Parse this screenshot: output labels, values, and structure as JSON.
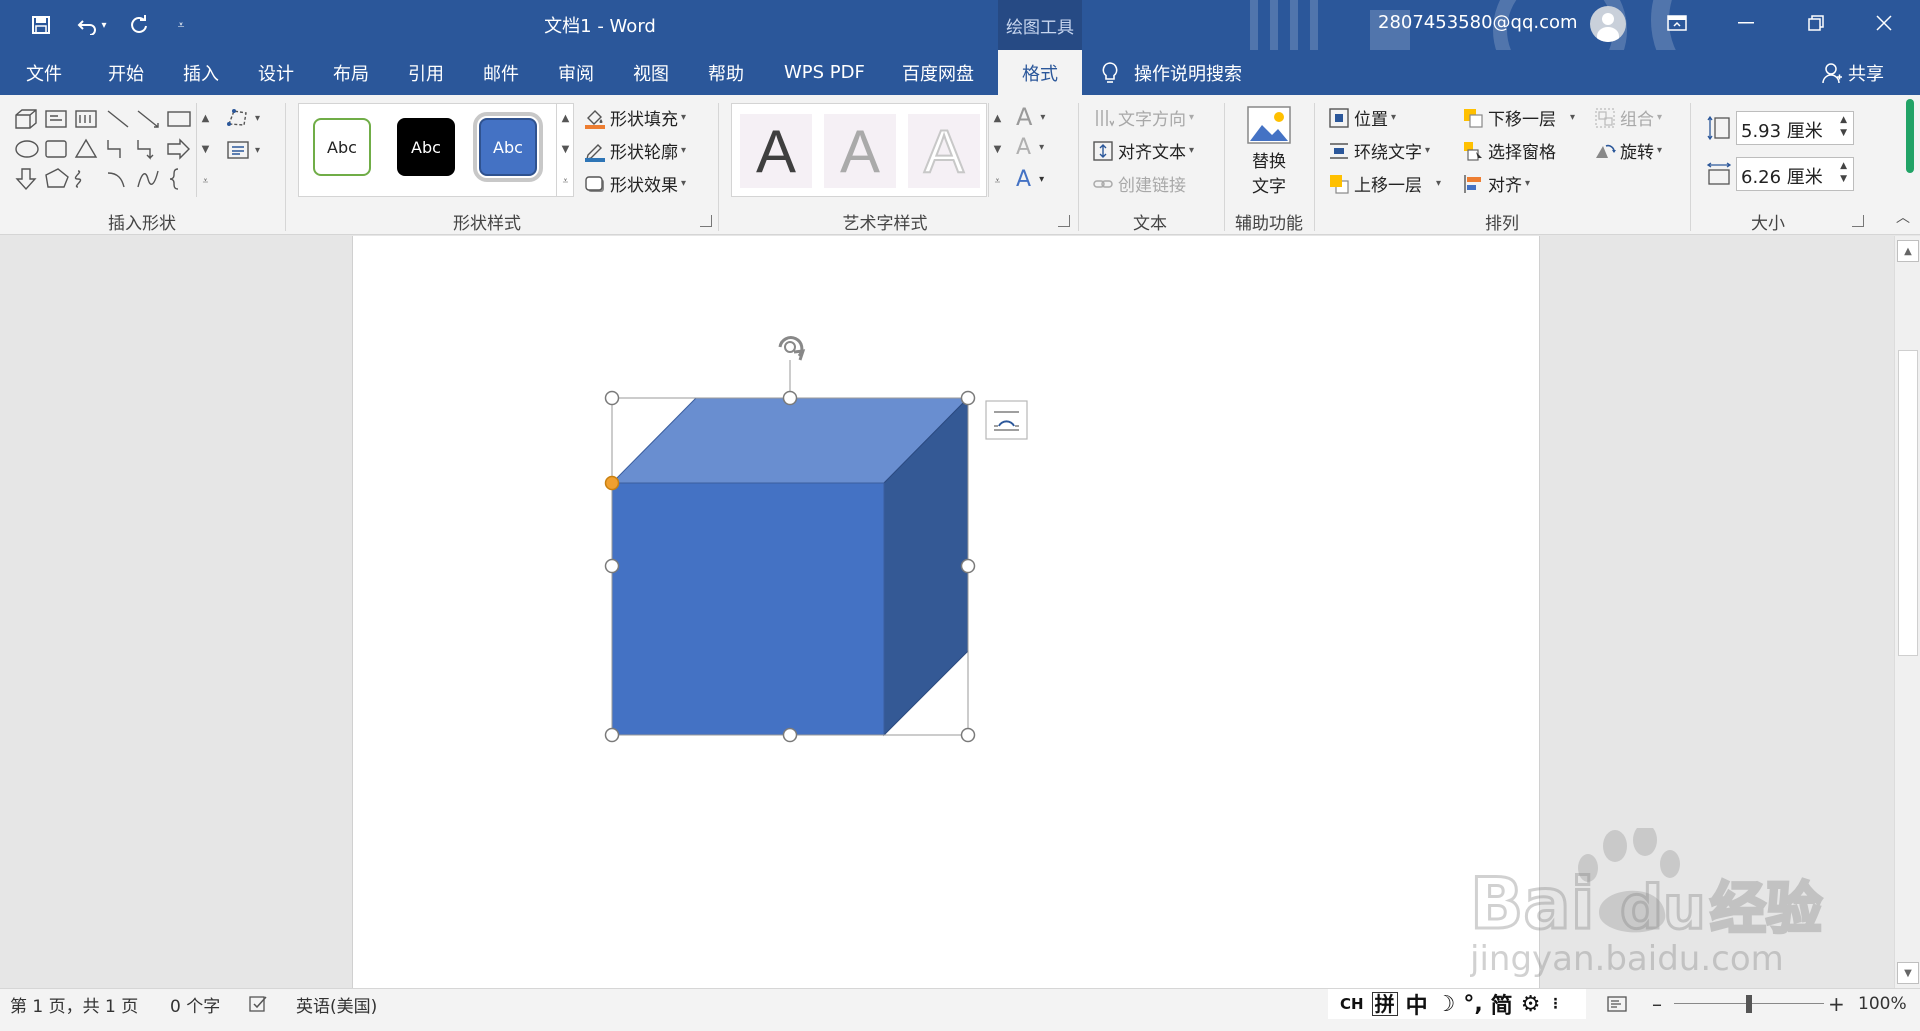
{
  "window": {
    "title": "文档1  -  Word",
    "context_tab_label": "绘图工具",
    "account": "2807453580@qq.com"
  },
  "quick_access": {
    "icons": [
      "save-icon",
      "undo-icon",
      "redo-icon",
      "customize-icon"
    ]
  },
  "tabs": [
    {
      "label": "文件"
    },
    {
      "label": "开始"
    },
    {
      "label": "插入"
    },
    {
      "label": "设计"
    },
    {
      "label": "布局"
    },
    {
      "label": "引用"
    },
    {
      "label": "邮件"
    },
    {
      "label": "审阅"
    },
    {
      "label": "视图"
    },
    {
      "label": "帮助"
    },
    {
      "label": "WPS PDF"
    },
    {
      "label": "百度网盘"
    },
    {
      "label": "格式",
      "active": true
    }
  ],
  "tell_me": "操作说明搜索",
  "share": "共享",
  "ribbon": {
    "groups": {
      "insert_shapes": "插入形状",
      "shape_styles": "形状样式",
      "wordart_styles": "艺术字样式",
      "text": "文本",
      "accessibility": "辅助功能",
      "arrange": "排列",
      "size": "大小"
    },
    "style_swatches": [
      "Abc",
      "Abc",
      "Abc"
    ],
    "shape_fill": "形状填充",
    "shape_outline": "形状轮廓",
    "shape_effects": "形状效果",
    "wordart_letter": "A",
    "text_direction": "文字方向",
    "align_text": "对齐文本",
    "create_link": "创建链接",
    "alt_text_line1": "替换",
    "alt_text_line2": "文字",
    "position": "位置",
    "wrap_text": "环绕文字",
    "bring_forward": "上移一层",
    "send_backward": "下移一层",
    "selection_pane": "选择窗格",
    "align": "对齐",
    "group": "组合",
    "rotate": "旋转",
    "height": "5.93 厘米",
    "width": "6.26 厘米"
  },
  "status": {
    "page": "第 1 页，共 1 页",
    "words": "0 个字",
    "language": "英语(美国)",
    "ime": [
      "CH",
      "拼",
      "中",
      "简"
    ],
    "zoom": "100%",
    "zoom_level": 1.0
  },
  "colors": {
    "word_blue": "#2b579a",
    "cube_front": "#4472c4",
    "cube_top": "#698ed0",
    "cube_side": "#345995"
  }
}
